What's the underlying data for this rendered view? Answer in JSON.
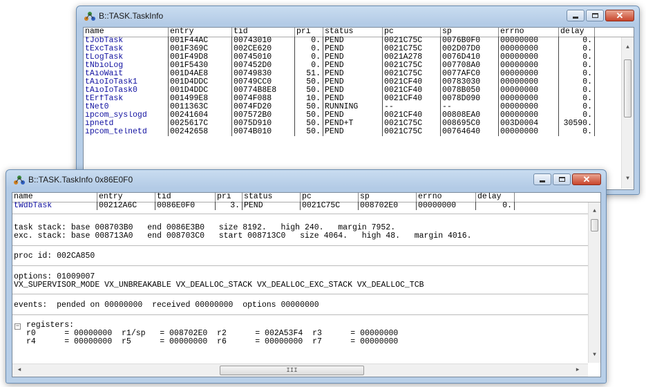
{
  "window1": {
    "title": "B::TASK.TaskInfo",
    "columns": [
      "name",
      "entry",
      "tid",
      "pri",
      "status",
      "pc",
      "sp",
      "errno",
      "delay"
    ],
    "rows": [
      [
        "tJobTask",
        "001F44AC",
        "00743010",
        "0.",
        "PEND",
        "0021C75C",
        "0076B0F0",
        "00000000",
        "0."
      ],
      [
        "tExcTask",
        "001F369C",
        "002CE620",
        "0.",
        "PEND",
        "0021C75C",
        "002D07D0",
        "00000000",
        "0."
      ],
      [
        "tLogTask",
        "001F49D8",
        "00745010",
        "0.",
        "PEND",
        "0021A278",
        "0076D410",
        "00000000",
        "0."
      ],
      [
        "tNbioLog",
        "001F5430",
        "007452D0",
        "0.",
        "PEND",
        "0021C75C",
        "007708A0",
        "00000000",
        "0."
      ],
      [
        "tAioWait",
        "001D4AE8",
        "00749830",
        "51.",
        "PEND",
        "0021C75C",
        "0077AFC0",
        "00000000",
        "0."
      ],
      [
        "tAioIoTask1",
        "001D4DDC",
        "00749CC0",
        "50.",
        "PEND",
        "0021CF40",
        "00783030",
        "00000000",
        "0."
      ],
      [
        "tAioIoTask0",
        "001D4DDC",
        "00774B8E8",
        "50.",
        "PEND",
        "0021CF40",
        "0078B050",
        "00000000",
        "0."
      ],
      [
        "tErfTask",
        "001499E8",
        "0074F088",
        "10.",
        "PEND",
        "0021CF40",
        "0078D090",
        "00000000",
        "0."
      ],
      [
        "tNet0",
        "0011363C",
        "0074FD20",
        "50.",
        "RUNNING",
        "--",
        "--",
        "00000000",
        "0."
      ],
      [
        "ipcom_syslogd",
        "00241604",
        "007572B0",
        "50.",
        "PEND",
        "0021CF40",
        "00808EA0",
        "00000000",
        "0."
      ],
      [
        "ipnetd",
        "0025617C",
        "0075D910",
        "50.",
        "PEND+T",
        "0021C75C",
        "008695C0",
        "003D0004",
        "30590."
      ],
      [
        "ipcom_telnetd",
        "00242658",
        "0074B010",
        "50.",
        "PEND",
        "0021C75C",
        "00764640",
        "00000000",
        "0."
      ]
    ]
  },
  "window2": {
    "title": "B::TASK.TaskInfo 0x86E0F0",
    "columns": [
      "name",
      "entry",
      "tid",
      "pri",
      "status",
      "pc",
      "sp",
      "errno",
      "delay"
    ],
    "row": [
      "tWdbTask",
      "00212A6C",
      "0086E0F0",
      "3.",
      "PEND",
      "0021C75C",
      "008702E0",
      "00000000",
      "0."
    ],
    "task_stack": "task stack: base 008703B0   end 0086E3B0   size 8192.   high 240.   margin 7952.",
    "exc_stack": "exc. stack: base 008713A0   end 008703C0   start 008713C0   size 4064.   high 48.   margin 4016.",
    "proc_id": "proc id: 002CA850",
    "options_line": "options: 01009007",
    "options_flags": "VX_SUPERVISOR_MODE VX_UNBREAKABLE VX_DEALLOC_STACK VX_DEALLOC_EXC_STACK VX_DEALLOC_TCB",
    "events": "events:  pended on 00000000  received 00000000  options 00000000",
    "registers_label": "registers:",
    "reg_line1": "r0      = 00000000  r1/sp   = 008702E0  r2      = 002A53F4  r3      = 00000000",
    "reg_line2": "r4      = 00000000  r5      = 00000000  r6      = 00000000  r7      = 00000000",
    "hscroll_grip": "III"
  }
}
